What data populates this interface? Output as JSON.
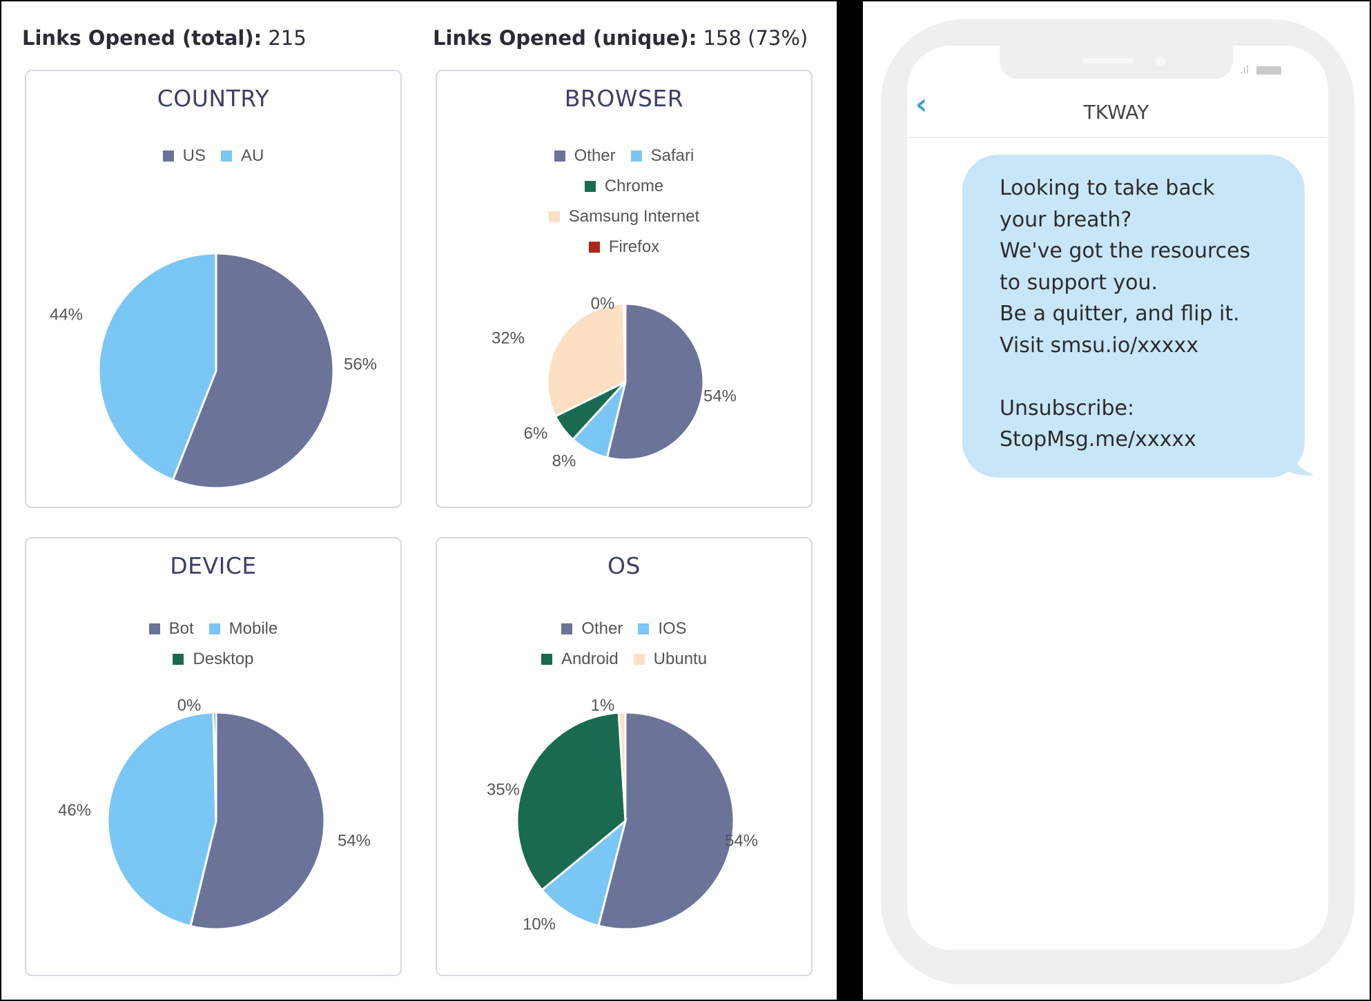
{
  "header_stats": {
    "total_label": "Links Opened (total):",
    "total_value": "215",
    "unique_label": "Links Opened (unique):",
    "unique_value": "158 (73%)"
  },
  "colors": {
    "slate": "#6b7399",
    "light_blue": "#7ac6f4",
    "dark_green": "#1a6a52",
    "peach": "#fbe0c4",
    "dark_red": "#b42318"
  },
  "chart_data": [
    {
      "type": "pie",
      "title": "COUNTRY",
      "labels": [
        "US",
        "AU"
      ],
      "values": [
        56,
        44
      ],
      "data_labels": [
        "56%",
        "44%"
      ],
      "colors": [
        "#6b7399",
        "#7ac6f4"
      ],
      "legend": "top"
    },
    {
      "type": "pie",
      "title": "BROWSER",
      "labels": [
        "Other",
        "Safari",
        "Chrome",
        "Samsung Internet",
        "Firefox"
      ],
      "values": [
        54,
        8,
        6,
        32,
        0.4
      ],
      "data_labels": [
        "54%",
        "8%",
        "6%",
        "32%",
        "0%"
      ],
      "colors": [
        "#6b7399",
        "#7ac6f4",
        "#1a6a52",
        "#fbe0c4",
        "#b42318"
      ],
      "legend": "top"
    },
    {
      "type": "pie",
      "title": "DEVICE",
      "labels": [
        "Bot",
        "Mobile",
        "Desktop"
      ],
      "values": [
        54,
        46,
        0.4
      ],
      "data_labels": [
        "54%",
        "46%",
        "0%"
      ],
      "colors": [
        "#6b7399",
        "#7ac6f4",
        "#1a6a52"
      ],
      "legend": "top"
    },
    {
      "type": "pie",
      "title": "OS",
      "labels": [
        "Other",
        "IOS",
        "Android",
        "Ubuntu"
      ],
      "values": [
        54,
        10,
        35,
        1
      ],
      "data_labels": [
        "54%",
        "10%",
        "35%",
        "1%"
      ],
      "colors": [
        "#6b7399",
        "#7ac6f4",
        "#1a6a52",
        "#fbe0c4"
      ],
      "legend": "top"
    }
  ],
  "phone": {
    "status_icons": "signal-icon battery-icon",
    "back_icon": "chevron-left-icon",
    "contact_name": "TKWAY",
    "message": "Looking to take back\nyour breath?\nWe've got the resources\nto support you.\nBe a quitter, and flip it.\nVisit smsu.io/xxxxx\n\nUnsubscribe:\nStopMsg.me/xxxxx"
  }
}
